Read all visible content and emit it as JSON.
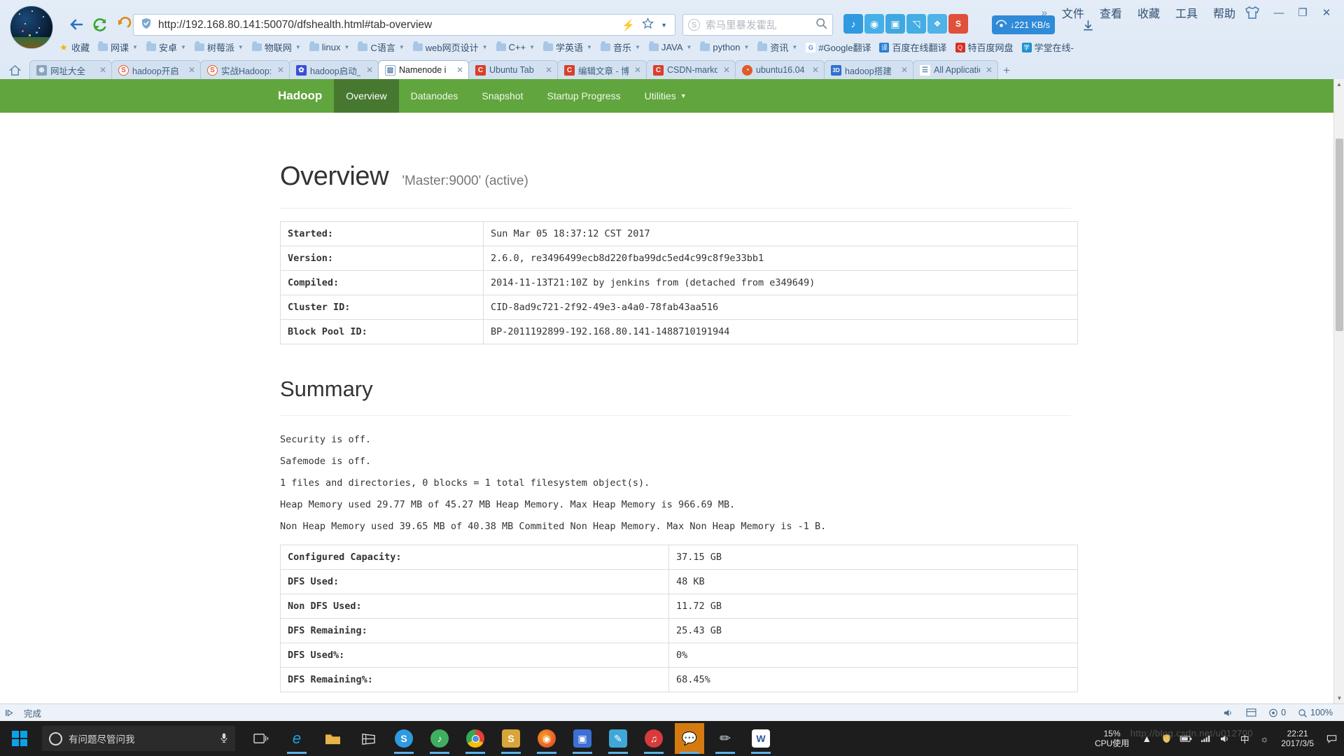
{
  "browser": {
    "menu": {
      "expand_icon": "chevron-double-right-icon",
      "items": [
        "文件",
        "查看",
        "收藏",
        "工具",
        "帮助"
      ]
    },
    "window_controls": {
      "skin_icon": "shirt-icon",
      "minimize": "—",
      "maximize": "❐",
      "close": "✕"
    },
    "nav": {
      "back_icon": "back-arrow-icon",
      "reload_icon": "reload-icon",
      "history_icon": "undo-arrow-icon"
    },
    "urlbar": {
      "security_icon": "shield-check-icon",
      "url": "http://192.168.80.141:50070/dfshealth.html#tab-overview",
      "lightning_icon": "lightning-icon",
      "bookmark_icon": "star-icon",
      "dropdown_icon": "chevron-down-icon"
    },
    "search": {
      "engine_icon": "sogou-logo-icon",
      "placeholder": "索马里暴发霍乱",
      "submit_icon": "search-icon"
    },
    "extensions": [
      {
        "name": "headphones-icon",
        "glyph": "♫",
        "color": "#2f9ae0"
      },
      {
        "name": "film-icon",
        "glyph": "◉",
        "color": "#45b0e8"
      },
      {
        "name": "screenshot-icon",
        "glyph": "▣",
        "color": "#3fa8e0"
      },
      {
        "name": "gamepad-icon",
        "glyph": "◱",
        "color": "#43ade4"
      },
      {
        "name": "puzzle-icon",
        "glyph": "❖",
        "color": "#4fb3e8"
      },
      {
        "name": "shield-red-icon",
        "glyph": "S",
        "color": "#e0503a"
      }
    ],
    "netspeed": {
      "icon": "speed-icon",
      "label": "↓221 KB/s"
    },
    "downloads_icon": "download-arrow-icon",
    "bookmarks": [
      {
        "label": "收藏",
        "icon": "star-icon",
        "type": "star",
        "caret": false
      },
      {
        "label": "网课",
        "icon": "folder-icon",
        "type": "folder",
        "caret": true
      },
      {
        "label": "安卓",
        "icon": "folder-icon",
        "type": "folder",
        "caret": true
      },
      {
        "label": "树莓派",
        "icon": "folder-icon",
        "type": "folder",
        "caret": true
      },
      {
        "label": "物联网",
        "icon": "folder-icon",
        "type": "folder",
        "caret": true
      },
      {
        "label": "linux",
        "icon": "folder-icon",
        "type": "folder",
        "caret": true
      },
      {
        "label": "C语言",
        "icon": "folder-icon",
        "type": "folder",
        "caret": true
      },
      {
        "label": "web网页设计",
        "icon": "folder-icon",
        "type": "folder",
        "caret": true
      },
      {
        "label": "C++",
        "icon": "folder-icon",
        "type": "folder",
        "caret": true
      },
      {
        "label": "学英语",
        "icon": "folder-icon",
        "type": "folder",
        "caret": true
      },
      {
        "label": "音乐",
        "icon": "folder-icon",
        "type": "folder",
        "caret": true
      },
      {
        "label": "JAVA",
        "icon": "folder-icon",
        "type": "folder",
        "caret": true
      },
      {
        "label": "python",
        "icon": "folder-icon",
        "type": "folder",
        "caret": true
      },
      {
        "label": "资讯",
        "icon": "folder-icon",
        "type": "folder",
        "caret": true
      },
      {
        "label": "#Google翻译",
        "icon": "google-icon",
        "type": "fav",
        "fav_color": "#4285f4",
        "fav_glyph": "G",
        "caret": false
      },
      {
        "label": "百度在线翻译",
        "icon": "baidu-icon",
        "type": "fav",
        "fav_color": "#2e7ed6",
        "fav_glyph": "译",
        "caret": false
      },
      {
        "label": "特百度网盘",
        "icon": "baidu-pan-icon",
        "type": "fav",
        "fav_color": "#d93025",
        "fav_glyph": "Q",
        "caret": false
      },
      {
        "label": "学堂在线-",
        "icon": "xuetang-icon",
        "type": "fav",
        "fav_color": "#1d8fd1",
        "fav_glyph": "学",
        "caret": false
      }
    ],
    "home_icon": "home-icon",
    "tabs": [
      {
        "label": "网址大全",
        "icon_glyph": "⊕",
        "icon_color": "#8aa4bd",
        "active": false
      },
      {
        "label": "hadoop开启",
        "icon_glyph": "S",
        "icon_color": "#e4562f",
        "active": false
      },
      {
        "label": "实战Hadoop:",
        "icon_glyph": "S",
        "icon_color": "#e4562f",
        "active": false
      },
      {
        "label": "hadoop启动_",
        "icon_glyph": "✿",
        "icon_color": "#3a4fd6",
        "active": false
      },
      {
        "label": "Namenode i",
        "icon_glyph": "▧",
        "icon_color": "#5a7fa8",
        "active": true
      },
      {
        "label": "Ubuntu Tab",
        "icon_glyph": "C",
        "icon_color": "#d93f2b",
        "active": false
      },
      {
        "label": "编辑文章 - 博",
        "icon_glyph": "C",
        "icon_color": "#d93f2b",
        "active": false
      },
      {
        "label": "CSDN-markd",
        "icon_glyph": "C",
        "icon_color": "#d93f2b",
        "active": false
      },
      {
        "label": "ubuntu16.04",
        "icon_glyph": "◔",
        "icon_color": "#e05a2b",
        "active": false
      },
      {
        "label": "hadoop搭建",
        "icon_glyph": "⚏",
        "icon_color": "#2f6fd0",
        "active": false
      },
      {
        "label": "All Applicatio",
        "icon_glyph": "☰",
        "icon_color": "#5a7fa8",
        "active": false
      }
    ],
    "new_tab_icon": "plus-icon",
    "scrollbar": {
      "up_icon": "chevron-up-icon",
      "down_icon": "chevron-down-icon"
    }
  },
  "hadoop": {
    "brand": "Hadoop",
    "nav": [
      {
        "label": "Overview",
        "active": true,
        "caret": false
      },
      {
        "label": "Datanodes",
        "active": false,
        "caret": false
      },
      {
        "label": "Snapshot",
        "active": false,
        "caret": false
      },
      {
        "label": "Startup Progress",
        "active": false,
        "caret": false
      },
      {
        "label": "Utilities",
        "active": false,
        "caret": true
      }
    ],
    "overview": {
      "title": "Overview",
      "subtitle": "'Master:9000' (active)",
      "rows": [
        {
          "key": "Started:",
          "value": "Sun Mar 05 18:37:12 CST 2017"
        },
        {
          "key": "Version:",
          "value": "2.6.0, re3496499ecb8d220fba99dc5ed4c99c8f9e33bb1"
        },
        {
          "key": "Compiled:",
          "value": "2014-11-13T21:10Z by jenkins from (detached from e349649)"
        },
        {
          "key": "Cluster ID:",
          "value": "CID-8ad9c721-2f92-49e3-a4a0-78fab43aa516"
        },
        {
          "key": "Block Pool ID:",
          "value": "BP-2011192899-192.168.80.141-1488710191944"
        }
      ]
    },
    "summary": {
      "title": "Summary",
      "lines": [
        "Security is off.",
        "Safemode is off.",
        "1 files and directories, 0 blocks = 1 total filesystem object(s).",
        "Heap Memory used 29.77 MB of 45.27 MB Heap Memory. Max Heap Memory is 966.69 MB.",
        "Non Heap Memory used 39.65 MB of 40.38 MB Commited Non Heap Memory. Max Non Heap Memory is -1 B."
      ],
      "rows": [
        {
          "key": "Configured Capacity:",
          "value": "37.15 GB"
        },
        {
          "key": "DFS Used:",
          "value": "48 KB"
        },
        {
          "key": "Non DFS Used:",
          "value": "11.72 GB"
        },
        {
          "key": "DFS Remaining:",
          "value": "25.43 GB"
        },
        {
          "key": "DFS Used%:",
          "value": "0%"
        },
        {
          "key": "DFS Remaining%:",
          "value": "68.45%"
        }
      ]
    }
  },
  "statusbar": {
    "play_icon": "media-play-icon",
    "text": "完成",
    "right": [
      {
        "icon": "volume-icon",
        "glyph": "🔊",
        "label": ""
      },
      {
        "icon": "window-split-icon",
        "glyph": "▤",
        "label": ""
      },
      {
        "icon": "shield-count-icon",
        "glyph": "◎",
        "label": "0"
      },
      {
        "icon": "zoom-level-icon",
        "glyph": "⊕",
        "label": "100%"
      }
    ]
  },
  "taskbar": {
    "start_icon": "windows-start-icon",
    "cortana": {
      "search_icon": "cortana-ring-icon",
      "placeholder": "有问题尽管问我",
      "mic_icon": "microphone-icon"
    },
    "task_view_icon": "task-view-icon",
    "apps": [
      {
        "name": "edge-icon",
        "glyph": "e",
        "color": "#1478bd",
        "open": true,
        "state": ""
      },
      {
        "name": "file-explorer-icon",
        "glyph": "🗁",
        "color": "#e8b34a",
        "open": false,
        "state": ""
      },
      {
        "name": "store-icon",
        "glyph": "⊞",
        "color": "#dddddd",
        "open": false,
        "state": ""
      },
      {
        "name": "sogou-browser-icon",
        "glyph": "S",
        "color": "#2f9ae0",
        "open": true,
        "state": ""
      },
      {
        "name": "netease-music-icon",
        "glyph": "♫",
        "color": "#3fae5f",
        "open": true,
        "state": ""
      },
      {
        "name": "chrome-icon",
        "glyph": "◎",
        "color": "#4a90e2",
        "open": true,
        "state": ""
      },
      {
        "name": "sublime-icon",
        "glyph": "S",
        "color": "#d8a53a",
        "open": true,
        "state": ""
      },
      {
        "name": "firefox-icon",
        "glyph": "◉",
        "color": "#e8832a",
        "open": true,
        "state": ""
      },
      {
        "name": "vmware-icon",
        "glyph": "▣",
        "color": "#3d6fd4",
        "open": true,
        "state": ""
      },
      {
        "name": "screenshot-tool-icon",
        "glyph": "✂",
        "color": "#3fa8d8",
        "open": true,
        "state": ""
      },
      {
        "name": "netease-cloud-icon",
        "glyph": "Ⓜ",
        "color": "#d93a3a",
        "open": true,
        "state": ""
      },
      {
        "name": "messenger-icon",
        "glyph": "💬",
        "color": "#e8e8e8",
        "open": true,
        "state": "highlight"
      },
      {
        "name": "paint-tool-icon",
        "glyph": "✎",
        "color": "#cfd6dd",
        "open": true,
        "state": ""
      },
      {
        "name": "word-icon",
        "glyph": "W",
        "color": "#2b579a",
        "open": true,
        "state": ""
      }
    ],
    "tray": {
      "cpu_percent": "15%",
      "cpu_label": "CPU使用",
      "expand_icon": "chevron-up-icon",
      "icons": [
        {
          "name": "security-icon",
          "glyph": "🛡"
        },
        {
          "name": "battery-icon",
          "glyph": "▭"
        },
        {
          "name": "network-icon",
          "glyph": "☰"
        },
        {
          "name": "volume-icon",
          "glyph": "🔊"
        },
        {
          "name": "ime-icon",
          "glyph": "中"
        },
        {
          "name": "ime-mode-icon",
          "glyph": "☼"
        }
      ],
      "time": "22:21",
      "date": "2017/3/5",
      "notification_icon": "notification-icon"
    }
  },
  "watermark": "http://blog.csdn.net/u012700"
}
